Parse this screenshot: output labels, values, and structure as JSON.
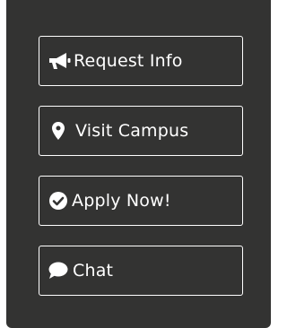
{
  "actions": [
    {
      "label": "Request Info",
      "icon": "megaphone-icon"
    },
    {
      "label": "Visit Campus",
      "icon": "map-marker-icon"
    },
    {
      "label": "Apply Now!",
      "icon": "check-circle-icon"
    },
    {
      "label": "Chat",
      "icon": "chat-bubble-icon"
    }
  ],
  "colors": {
    "panel_bg": "#333332",
    "button_border": "#ffffff",
    "text": "#ffffff"
  }
}
